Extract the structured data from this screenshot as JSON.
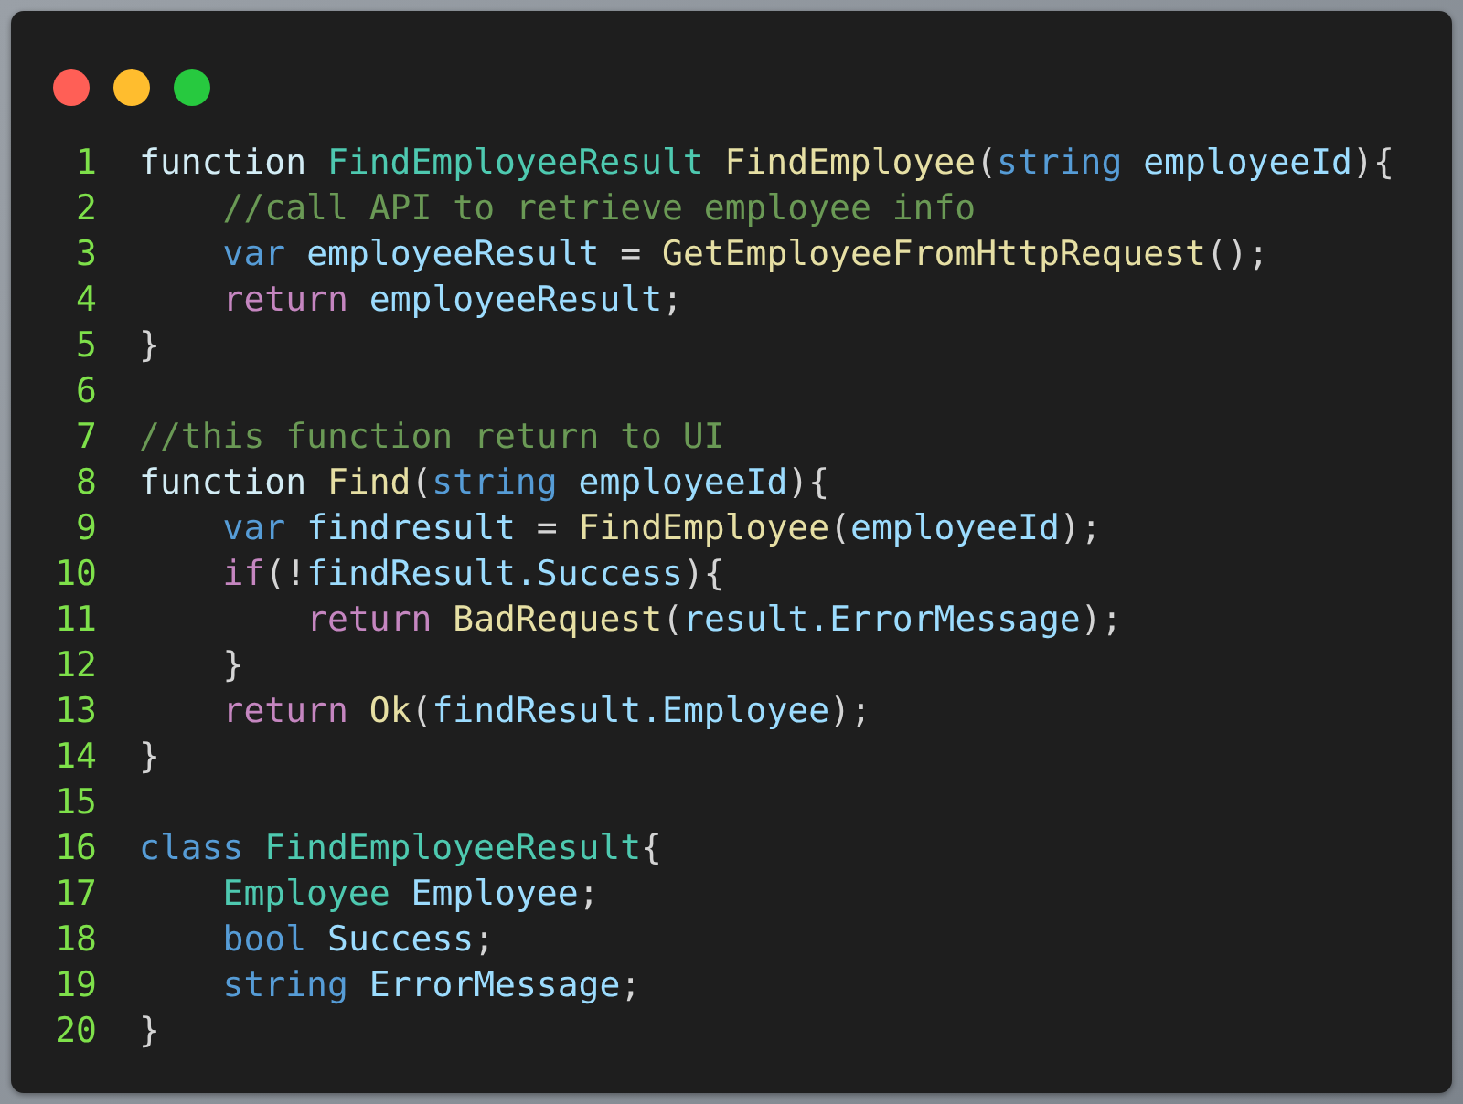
{
  "window_controls": [
    {
      "color": "#ff5f56"
    },
    {
      "color": "#ffbd2e"
    },
    {
      "color": "#27c93f"
    }
  ],
  "code_lines": [
    {
      "number": "1",
      "tokens": [
        {
          "kind": "keyword",
          "text": "function "
        },
        {
          "kind": "type",
          "text": "FindEmployeeResult "
        },
        {
          "kind": "func",
          "text": "FindEmployee"
        },
        {
          "kind": "punct",
          "text": "("
        },
        {
          "kind": "storage",
          "text": "string "
        },
        {
          "kind": "var",
          "text": "employeeId"
        },
        {
          "kind": "punct",
          "text": "){"
        }
      ],
      "children": [
        {
          "number": "2",
          "tokens": [
            {
              "kind": "comment",
              "text": "//call API to retrieve employee info"
            }
          ]
        },
        {
          "number": "3",
          "tokens": [
            {
              "kind": "storage",
              "text": "var "
            },
            {
              "kind": "var",
              "text": "employeeResult "
            },
            {
              "kind": "punct",
              "text": "= "
            },
            {
              "kind": "func",
              "text": "GetEmployeeFromHttpRequest"
            },
            {
              "kind": "punct",
              "text": "();"
            }
          ]
        },
        {
          "number": "4",
          "tokens": [
            {
              "kind": "control",
              "text": "return "
            },
            {
              "kind": "var",
              "text": "employeeResult"
            },
            {
              "kind": "punct",
              "text": ";"
            }
          ]
        }
      ]
    },
    {
      "number": "5",
      "tokens": [
        {
          "kind": "punct",
          "text": "}"
        }
      ]
    },
    {
      "number": "6"
    },
    {
      "number": "7",
      "tokens": [
        {
          "kind": "comment",
          "text": "//this function return to UI"
        }
      ]
    },
    {
      "number": "8",
      "tokens": [
        {
          "kind": "keyword",
          "text": "function "
        },
        {
          "kind": "func",
          "text": "Find"
        },
        {
          "kind": "punct",
          "text": "("
        },
        {
          "kind": "storage",
          "text": "string "
        },
        {
          "kind": "var",
          "text": "employeeId"
        },
        {
          "kind": "punct",
          "text": "){"
        }
      ],
      "children": [
        {
          "number": "9",
          "tokens": [
            {
              "kind": "storage",
              "text": "var "
            },
            {
              "kind": "var",
              "text": "findresult "
            },
            {
              "kind": "punct",
              "text": "= "
            },
            {
              "kind": "func",
              "text": "FindEmployee"
            },
            {
              "kind": "punct",
              "text": "("
            },
            {
              "kind": "var",
              "text": "employeeId"
            },
            {
              "kind": "punct",
              "text": ");"
            }
          ]
        },
        {
          "number": "10",
          "tokens": [
            {
              "kind": "control",
              "text": "if"
            },
            {
              "kind": "punct",
              "text": "(!"
            },
            {
              "kind": "var",
              "text": "findResult.Success"
            },
            {
              "kind": "punct",
              "text": "){"
            }
          ],
          "children": [
            {
              "number": "11",
              "tokens": [
                {
                  "kind": "control",
                  "text": "return "
                },
                {
                  "kind": "func",
                  "text": "BadRequest"
                },
                {
                  "kind": "punct",
                  "text": "("
                },
                {
                  "kind": "var",
                  "text": "result.ErrorMessage"
                },
                {
                  "kind": "punct",
                  "text": ");"
                }
              ]
            }
          ]
        },
        {
          "number": "12",
          "tokens": [
            {
              "kind": "punct",
              "text": "}"
            }
          ]
        },
        {
          "number": "13",
          "tokens": [
            {
              "kind": "control",
              "text": "return "
            },
            {
              "kind": "func",
              "text": "Ok"
            },
            {
              "kind": "punct",
              "text": "("
            },
            {
              "kind": "var",
              "text": "findResult.Employee"
            },
            {
              "kind": "punct",
              "text": ");"
            }
          ]
        }
      ]
    },
    {
      "number": "14",
      "tokens": [
        {
          "kind": "punct",
          "text": "}"
        }
      ]
    },
    {
      "number": "15"
    },
    {
      "number": "16",
      "tokens": [
        {
          "kind": "storage",
          "text": "class "
        },
        {
          "kind": "type",
          "text": "FindEmployeeResult"
        },
        {
          "kind": "punct",
          "text": "{"
        }
      ],
      "children": [
        {
          "number": "17",
          "tokens": [
            {
              "kind": "type",
              "text": "Employee "
            },
            {
              "kind": "var",
              "text": "Employee"
            },
            {
              "kind": "punct",
              "text": ";"
            }
          ]
        },
        {
          "number": "18",
          "tokens": [
            {
              "kind": "storage",
              "text": "bool "
            },
            {
              "kind": "var",
              "text": "Success"
            },
            {
              "kind": "punct",
              "text": ";"
            }
          ]
        },
        {
          "number": "19",
          "tokens": [
            {
              "kind": "storage",
              "text": "string "
            },
            {
              "kind": "var",
              "text": "ErrorMessage"
            },
            {
              "kind": "punct",
              "text": ";"
            }
          ]
        }
      ]
    },
    {
      "number": "20",
      "tokens": [
        {
          "kind": "punct",
          "text": "}"
        }
      ]
    }
  ]
}
